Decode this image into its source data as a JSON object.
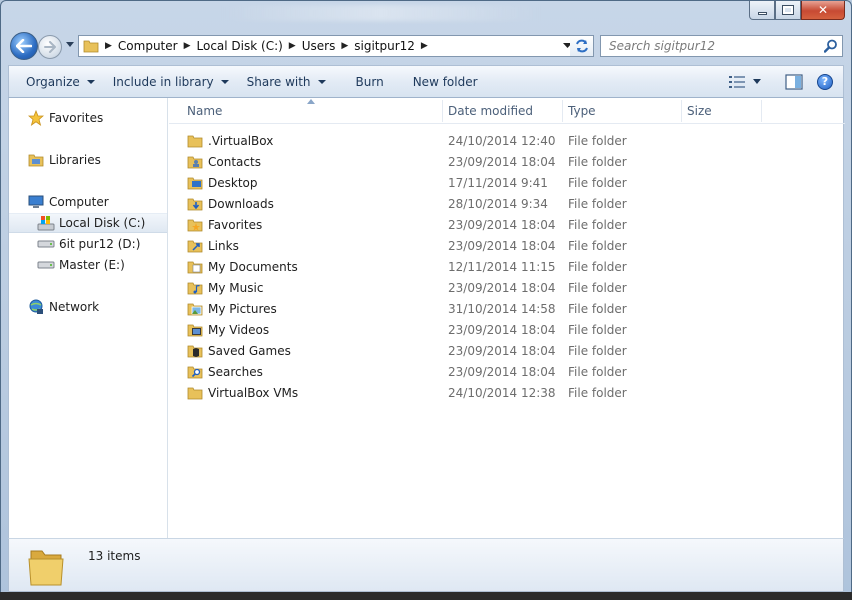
{
  "window": {
    "minimize_label": "",
    "close_glyph": "✕"
  },
  "address": {
    "crumbs": [
      "Computer",
      "Local Disk (C:)",
      "Users",
      "sigitpur12"
    ]
  },
  "search": {
    "placeholder": "Search sigitpur12"
  },
  "toolbar": {
    "organize": "Organize",
    "include": "Include in library",
    "share": "Share with",
    "burn": "Burn",
    "new_folder": "New folder",
    "help": "?"
  },
  "sidebar": {
    "favorites": "Favorites",
    "libraries": "Libraries",
    "computer": "Computer",
    "local_disk": "Local Disk (C:)",
    "drive_d": "6it pur12 (D:)",
    "drive_e": "Master (E:)",
    "network": "Network"
  },
  "columns": {
    "name": "Name",
    "date": "Date modified",
    "type": "Type",
    "size": "Size"
  },
  "files": [
    {
      "name": ".VirtualBox",
      "date": "24/10/2014 12:40",
      "type": "File folder",
      "icon": "folder-icon"
    },
    {
      "name": "Contacts",
      "date": "23/09/2014 18:04",
      "type": "File folder",
      "icon": "contacts-folder-icon"
    },
    {
      "name": "Desktop",
      "date": "17/11/2014 9:41",
      "type": "File folder",
      "icon": "desktop-folder-icon"
    },
    {
      "name": "Downloads",
      "date": "28/10/2014 9:34",
      "type": "File folder",
      "icon": "downloads-folder-icon"
    },
    {
      "name": "Favorites",
      "date": "23/09/2014 18:04",
      "type": "File folder",
      "icon": "favorites-folder-icon"
    },
    {
      "name": "Links",
      "date": "23/09/2014 18:04",
      "type": "File folder",
      "icon": "links-folder-icon"
    },
    {
      "name": "My Documents",
      "date": "12/11/2014 11:15",
      "type": "File folder",
      "icon": "documents-folder-icon"
    },
    {
      "name": "My Music",
      "date": "23/09/2014 18:04",
      "type": "File folder",
      "icon": "music-folder-icon"
    },
    {
      "name": "My Pictures",
      "date": "31/10/2014 14:58",
      "type": "File folder",
      "icon": "pictures-folder-icon"
    },
    {
      "name": "My Videos",
      "date": "23/09/2014 18:04",
      "type": "File folder",
      "icon": "videos-folder-icon"
    },
    {
      "name": "Saved Games",
      "date": "23/09/2014 18:04",
      "type": "File folder",
      "icon": "games-folder-icon"
    },
    {
      "name": "Searches",
      "date": "23/09/2014 18:04",
      "type": "File folder",
      "icon": "searches-folder-icon"
    },
    {
      "name": "VirtualBox VMs",
      "date": "24/10/2014 12:38",
      "type": "File folder",
      "icon": "folder-icon"
    }
  ],
  "details": {
    "count": "13 items"
  },
  "colors": {
    "accent": "#1e395b",
    "folder": "#e8c15a",
    "back_button": "#2c6cc2"
  }
}
